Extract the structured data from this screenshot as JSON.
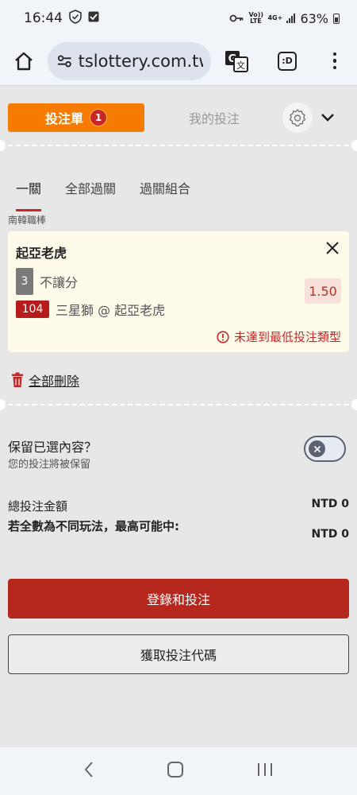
{
  "status_bar": {
    "time": "16:44",
    "volte": "Vo)) LTE",
    "network": "4G+",
    "battery": "63%"
  },
  "browser": {
    "url": "tslottery.com.tw",
    "tabs_label": ":D"
  },
  "betslip": {
    "tab_active_label": "投注單",
    "count": "1",
    "tab_inactive_label": "我的投注"
  },
  "bet_types": [
    {
      "label": "一關"
    },
    {
      "label": "全部過關"
    },
    {
      "label": "過關組合"
    }
  ],
  "bet": {
    "league": "南韓職棒",
    "team": "起亞老虎",
    "market_badge": "3",
    "market": "不讓分",
    "match_badge": "104",
    "match": "三星獅 @ 起亞老虎",
    "odds": "1.50",
    "warning": "未達到最低投注類型"
  },
  "delete_all_label": "全部刪除",
  "keep": {
    "title": "保留已選內容？",
    "subtitle": "您的投注將被保留"
  },
  "totals": {
    "total_label": "總投注金額",
    "total_value": "NTD 0",
    "max_label": "若全數為不同玩法，最高可能中:",
    "max_value": "NTD 0"
  },
  "buttons": {
    "login_bet": "登錄和投注",
    "get_code": "獲取投注代碼"
  },
  "colors": {
    "accent_orange": "#f57c00",
    "primary_red": "#b6271e",
    "odds_text": "#b53025"
  }
}
